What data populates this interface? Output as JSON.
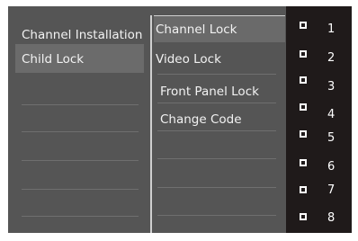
{
  "menu": {
    "left": [
      {
        "label": "Channel Installation"
      },
      {
        "label": "Child Lock"
      }
    ],
    "middle": [
      {
        "label": "Channel Lock"
      },
      {
        "label": "Video Lock"
      },
      {
        "label": "Front Panel Lock"
      },
      {
        "label": "Change Code"
      }
    ]
  },
  "channel_list": [
    {
      "number": "1",
      "checked": false
    },
    {
      "number": "2",
      "checked": false
    },
    {
      "number": "3",
      "checked": false
    },
    {
      "number": "4",
      "checked": false
    },
    {
      "number": "5",
      "checked": false
    },
    {
      "number": "6",
      "checked": false
    },
    {
      "number": "7",
      "checked": false
    },
    {
      "number": "8",
      "checked": false
    }
  ],
  "colors": {
    "panel": "#555555",
    "highlight": "#6b6b6b",
    "list_bg": "#1f1a1a",
    "text": "#f2f2f2"
  }
}
